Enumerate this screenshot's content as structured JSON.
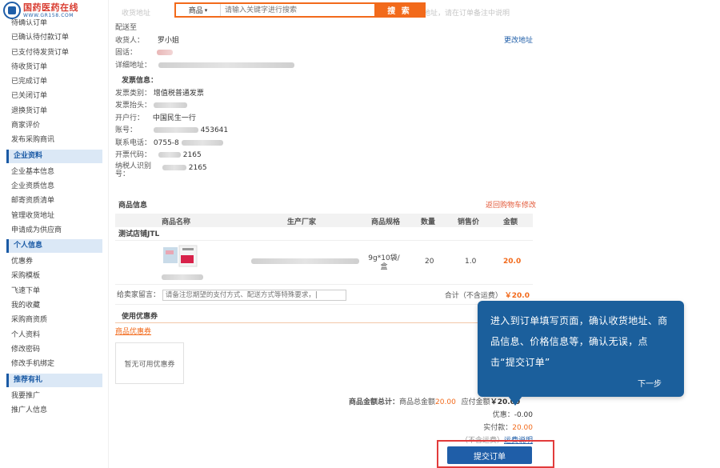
{
  "logo": {
    "cn": "国药医药在线",
    "url": "WWW.GR158.COM"
  },
  "sidebar": {
    "items_top": [
      "待确认订单",
      "已确认待付款订单",
      "已支付待发货订单",
      "待收货订单",
      "已完成订单",
      "已关闭订单",
      "退换货订单",
      "商家评价",
      "发布采购商讯"
    ],
    "section1": "企业资料",
    "items1": [
      "企业基本信息",
      "企业资质信息",
      "邮寄资质清单",
      "管理收货地址",
      "申请成为供应商"
    ],
    "section2": "个人信息",
    "items2": [
      "优惠券",
      "采购模板",
      "飞速下单",
      "我的收藏",
      "采购商资质",
      "个人资料",
      "修改密码",
      "修改手机绑定"
    ],
    "section3": "推荐有礼",
    "items3": [
      "我要推广",
      "推广人信息"
    ]
  },
  "topbar": {
    "ghost_left": "收货地址",
    "ghost_right": "地址，请在订单备注中说明",
    "category": "商品",
    "placeholder": "请输入关键字进行搜索",
    "search_btn": "搜 索"
  },
  "delivery": {
    "title": "配送至",
    "recipient_label": "收货人：",
    "recipient": "罗小姐",
    "phone_label": "固话：",
    "address_label": "详细地址：",
    "change_link": "更改地址"
  },
  "invoice": {
    "title": "发票信息：",
    "type_label": "发票类别：",
    "type": "增值税普通发票",
    "header_label": "发票抬头：",
    "bank_label": "开户行：",
    "bank": "中国民生一行",
    "account_label": "账号：",
    "account_tail": "453641",
    "phone_label": "联系电话：",
    "phone_head": "0755-8",
    "code_label": "开票代码：",
    "code_tail": "2165",
    "taxid_label": "纳税人识别号：",
    "taxid_tail": "2165"
  },
  "goods": {
    "title": "商品信息",
    "back_link": "返回购物车修改",
    "headers": [
      "商品名称",
      "生产厂家",
      "商品规格",
      "数量",
      "销售价",
      "金额"
    ],
    "shop": "测试店铺JTL",
    "item": {
      "spec": "9g*10袋/盒",
      "qty": "20",
      "price": "1.0",
      "amount": "20.0"
    },
    "message_label": "给卖家留言：",
    "message_placeholder": "请备注您期望的支付方式、配送方式等特殊要求，|",
    "subtotal_label": "合计（不含运费）",
    "subtotal": "￥20.0"
  },
  "coupon": {
    "title": "使用优惠券",
    "tab": "商品优惠券",
    "empty": "暂无可用优惠券"
  },
  "summary": {
    "total_label": "商品金额总计：",
    "goods_total_label": "商品总金额",
    "goods_total": "20.00",
    "payable_label": "应付金额",
    "payable": "￥20.00",
    "discount_label": "优惠：",
    "discount": "-0.00",
    "paid_label": "实付款：",
    "paid": "20.00",
    "shipping_note": "（不含运费）",
    "shipping_link": "运费说明",
    "submit": "提交订单"
  },
  "tooltip": {
    "text": "进入到订单填写页面，确认收货地址、商品信息、价格信息等，确认无误，点击“提交订单”",
    "next": "下一步"
  },
  "colors": {
    "primary": "#1f5ea8",
    "accent": "#f26a1b",
    "highlight": "#e23b3b",
    "tooltip": "#1b5f9c"
  }
}
